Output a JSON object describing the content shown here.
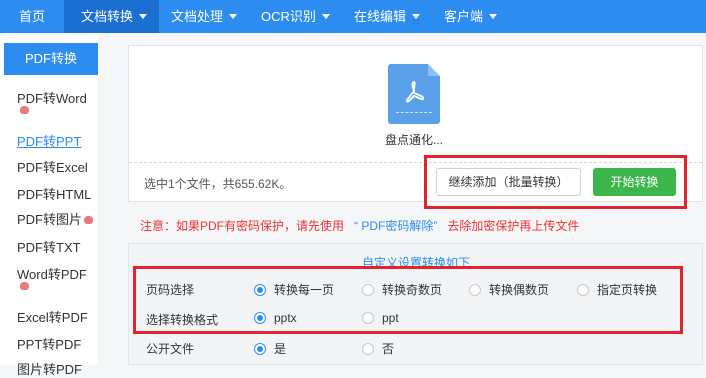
{
  "colors": {
    "primary": "#2d8cf0",
    "success": "#3cb54a",
    "warning_text": "#ee3333",
    "highlight_border": "#e0242d"
  },
  "topnav": {
    "items": [
      {
        "label": "首页",
        "dropdown": false,
        "active": false
      },
      {
        "label": "文档转换",
        "dropdown": true,
        "active": true
      },
      {
        "label": "文档处理",
        "dropdown": true,
        "active": false
      },
      {
        "label": "OCR识别",
        "dropdown": true,
        "active": false
      },
      {
        "label": "在线编辑",
        "dropdown": true,
        "active": false
      },
      {
        "label": "客户端",
        "dropdown": true,
        "active": false
      }
    ]
  },
  "sidebar": {
    "header": "PDF转换",
    "items": [
      {
        "label": "PDF转Word",
        "hot": true,
        "current": false
      },
      {
        "label": "PDF转PPT",
        "hot": false,
        "current": true
      },
      {
        "label": "PDF转Excel",
        "hot": false,
        "current": false
      },
      {
        "label": "PDF转HTML",
        "hot": false,
        "current": false
      },
      {
        "label": "PDF转图片",
        "hot": true,
        "current": false
      },
      {
        "label": "PDF转TXT",
        "hot": false,
        "current": false
      },
      {
        "label": "Word转PDF",
        "hot": true,
        "current": false
      },
      {
        "label": "Excel转PDF",
        "hot": false,
        "current": false
      },
      {
        "label": "PPT转PDF",
        "hot": false,
        "current": false
      },
      {
        "label": "图片转PDF",
        "hot": false,
        "current": false
      }
    ]
  },
  "upload": {
    "file_icon": "pdf-file-icon",
    "file_name": "盘点通化...",
    "summary": "选中1个文件，共655.62K。",
    "add_button": "继续添加（批量转换）",
    "start_button": "开始转换"
  },
  "notice": {
    "prefix": "注意：如果PDF有密码保护，请先使用",
    "link": "“ PDF密码解除”",
    "suffix": "去除加密保护再上传文件"
  },
  "settings": {
    "title": "自定义设置转换如下",
    "page_select": {
      "label": "页码选择",
      "options": [
        {
          "label": "转换每一页",
          "selected": true
        },
        {
          "label": "转换奇数页",
          "selected": false
        },
        {
          "label": "转换偶数页",
          "selected": false
        },
        {
          "label": "指定页转换",
          "selected": false
        }
      ]
    },
    "format_select": {
      "label": "选择转换格式",
      "options": [
        {
          "label": "pptx",
          "selected": true
        },
        {
          "label": "ppt",
          "selected": false
        }
      ]
    },
    "public_file": {
      "label": "公开文件",
      "options": [
        {
          "label": "是",
          "selected": true
        },
        {
          "label": "否",
          "selected": false
        }
      ]
    }
  }
}
